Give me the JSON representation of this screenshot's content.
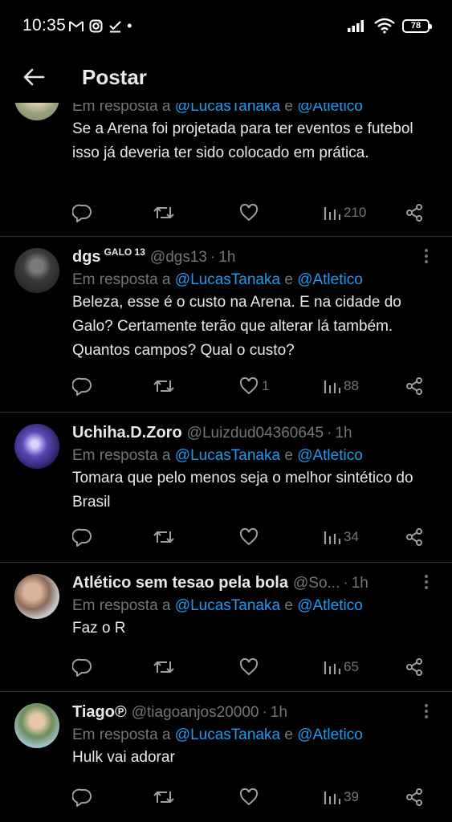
{
  "status_bar": {
    "time": "10:35",
    "dot": "•",
    "battery": "78"
  },
  "header": {
    "title": "Postar"
  },
  "colors": {
    "background": "#000000",
    "text": "#e7e9ea",
    "muted": "#71767b",
    "link": "#1d9bf0",
    "divider": "#2f3336"
  },
  "icons": {
    "back": "arrow-left-icon",
    "reply": "reply-icon",
    "retweet": "retweet-icon",
    "like": "heart-icon",
    "views": "views-icon",
    "share": "share-icon",
    "more": "more-vertical-icon"
  },
  "tweets": [
    {
      "reply_prefix": "Em resposta a",
      "mention1": "@LucasTanaka",
      "and": "e",
      "mention2": "@Atletico",
      "text": "Se a Arena foi projetada para ter eventos e futebol isso já deveria ter sido colocado em prática.",
      "views": "210"
    },
    {
      "name": "dgs",
      "badge": "GALO 13",
      "handle": "@dgs13",
      "sep": "·",
      "time": "1h",
      "reply_prefix": "Em resposta a",
      "mention1": "@LucasTanaka",
      "and": "e",
      "mention2": "@Atletico",
      "text": "Beleza, esse é o custo na Arena. E na cidade do Galo? Certamente terão que alterar lá também. Quantos campos? Qual o custo?",
      "likes": "1",
      "views": "88"
    },
    {
      "name": "Uchiha.D.Zoro",
      "handle": "@Luizdud04360645",
      "sep": "·",
      "time": "1h",
      "reply_prefix": "Em resposta a",
      "mention1": "@LucasTanaka",
      "and": "e",
      "mention2": "@Atletico",
      "text": "Tomara que pelo menos seja o melhor sintético do Brasil",
      "views": "34"
    },
    {
      "name": "Atlético sem tesao pela bola",
      "handle": "@So...",
      "sep": "·",
      "time": "1h",
      "reply_prefix": "Em resposta a",
      "mention1": "@LucasTanaka",
      "and": "e",
      "mention2": "@Atletico",
      "text": "Faz o R",
      "views": "65"
    },
    {
      "name": "Tiago℗",
      "handle": "@tiagoanjos20000",
      "sep": "·",
      "time": "1h",
      "reply_prefix": "Em resposta a",
      "mention1": "@LucasTanaka",
      "and": "e",
      "mention2": "@Atletico",
      "text": "Hulk vai adorar",
      "views": "39"
    }
  ]
}
